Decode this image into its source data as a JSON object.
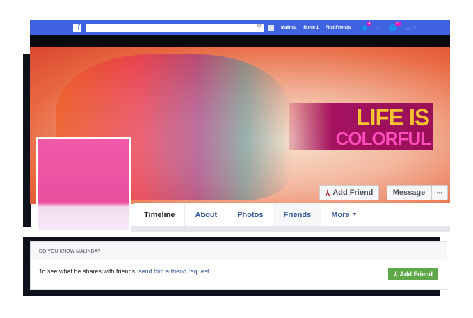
{
  "topbar": {
    "user": "Malinda",
    "home": "Home",
    "home_count": "1",
    "find_friends": "Find Friends",
    "friend_requests_badge": "4",
    "notifications_badge": "17"
  },
  "cover": {
    "headline_line1": "LIFE IS",
    "headline_line2": "COLORFUL",
    "add_friend": "Add Friend",
    "message": "Message",
    "more_dots": "•••"
  },
  "tabs": [
    "Timeline",
    "About",
    "Photos",
    "Friends",
    "More"
  ],
  "card": {
    "title": "DO YOU KNOW MALINDA?",
    "text": "To see what he shares with friends, ",
    "link": "send him a friend request",
    "button": "Add Friend"
  }
}
